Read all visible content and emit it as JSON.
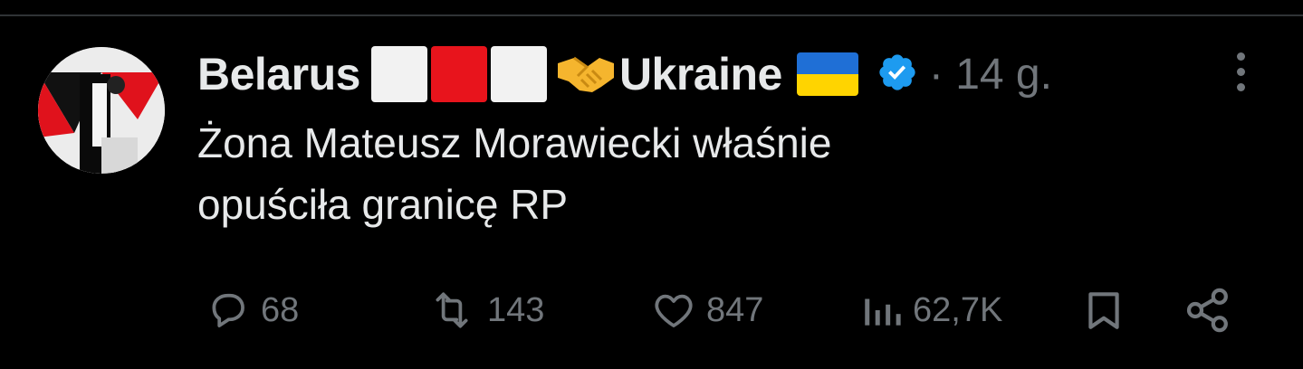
{
  "tweet": {
    "author_name": "Belarus",
    "author_name_suffix": "Ukraine",
    "time": "· 14 g.",
    "text_line1": "Żona Mateusz Morawiecki właśnie",
    "text_line2": "opuściła granicę RP",
    "icons": {
      "verified": "verified-badge-icon",
      "more": "more-options-icon",
      "handshake": "handshake-emoji",
      "belarus_flag": "white-red-white-flag",
      "ukraine_flag": "ukraine-flag"
    }
  },
  "actions": {
    "reply_count": "68",
    "retweet_count": "143",
    "like_count": "847",
    "views_count": "62,7K"
  },
  "colors": {
    "background": "#000000",
    "text": "#e7e9ea",
    "muted": "#71767b",
    "verified": "#1d9bf0",
    "red": "#e8141c",
    "ua_blue": "#1f6fd6",
    "ua_yellow": "#ffd400"
  }
}
